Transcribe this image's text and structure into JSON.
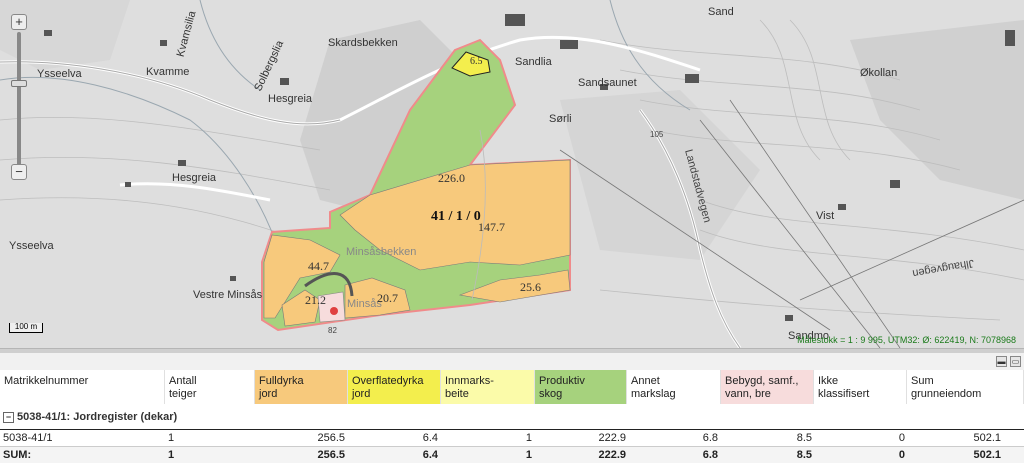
{
  "map": {
    "places": [
      "Ysseelva",
      "Kvamme",
      "Kvamsilia",
      "Solbergslia",
      "Hesgreia",
      "Hesgreia",
      "Skardsbekken",
      "Sandlia",
      "Sand",
      "Sandsaunet",
      "Økollan",
      "Sørli",
      "Landstadvegen",
      "Ysseelva",
      "Minsåsbekken",
      "Vestre Minsås",
      "Minsås",
      "Vist",
      "Jlhaugvegen",
      "Sandmo"
    ],
    "parcel_areas": [
      "6.5",
      "226.0",
      "147.7",
      "44.7",
      "21.2",
      "20.7",
      "25.6"
    ],
    "parcel_id": "41 / 1 / 0",
    "road_numbers": [
      "105",
      "82"
    ],
    "scalebar": "100 m",
    "scale_text": "Målestokk = 1 : 9 995, UTM32: Ø: 622419, N: 7078968",
    "zoom_in": "+",
    "zoom_out": "−",
    "colors": {
      "fulldyrka": "#f7c97c",
      "overflatedyrka": "#f3ee4d",
      "innmarksbeite": "#fbfba9",
      "produktiv_skog": "#a6d27d",
      "bebygd": "#f7dcdc",
      "parcel_border": "#f08b8b"
    }
  },
  "panel": {
    "min_icon": "▬",
    "max_icon": "▭"
  },
  "table": {
    "headers": [
      {
        "l1": "Matrikkelnummer",
        "l2": "",
        "bg": "#ffffff"
      },
      {
        "l1": "Antall",
        "l2": "teiger",
        "bg": "#ffffff"
      },
      {
        "l1": "Fulldyrka",
        "l2": "jord",
        "bg": "#f7c97c"
      },
      {
        "l1": "Overflatedyrka",
        "l2": "jord",
        "bg": "#f3ee4d"
      },
      {
        "l1": "Innmarks-",
        "l2": "beite",
        "bg": "#fbfba9"
      },
      {
        "l1": "Produktiv",
        "l2": "skog",
        "bg": "#a6d27d"
      },
      {
        "l1": "Annet",
        "l2": "markslag",
        "bg": "#ffffff"
      },
      {
        "l1": "Bebygd, samf.,",
        "l2": "vann, bre",
        "bg": "#f7dcdc"
      },
      {
        "l1": "Ikke",
        "l2": "klassifisert",
        "bg": "#ffffff"
      },
      {
        "l1": "Sum",
        "l2": "grunneiendom",
        "bg": "#ffffff"
      }
    ],
    "group_label": "5038-41/1: Jordregister (dekar)",
    "group_toggle": "−",
    "rows": [
      {
        "matrikkel": "5038-41/1",
        "teiger": "1",
        "fulldyrka": "256.5",
        "overflatedyrka": "6.4",
        "innmarksbeite": "1",
        "skog": "222.9",
        "annet": "6.8",
        "bebygd": "8.5",
        "ikke": "0",
        "sum": "502.1"
      }
    ],
    "sum_row": {
      "matrikkel": "SUM:",
      "teiger": "1",
      "fulldyrka": "256.5",
      "overflatedyrka": "6.4",
      "innmarksbeite": "1",
      "skog": "222.9",
      "annet": "6.8",
      "bebygd": "8.5",
      "ikke": "0",
      "sum": "502.1"
    }
  }
}
